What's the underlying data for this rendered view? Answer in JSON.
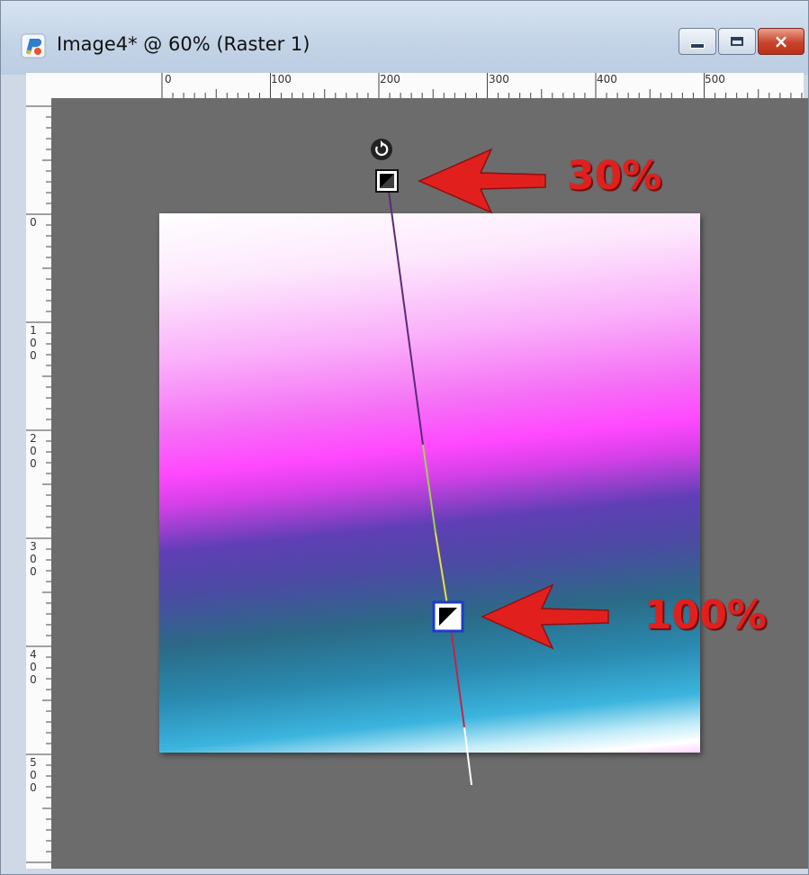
{
  "window": {
    "title": "Image4* @  60% (Raster 1)",
    "icon": "paintshop-pro-icon",
    "buttons": {
      "minimize": "minimize-icon",
      "maximize": "maximize-icon",
      "close_label": "×"
    }
  },
  "rulers": {
    "horizontal_labels": [
      "0",
      "100",
      "200",
      "300",
      "400",
      "500"
    ],
    "vertical_labels": [
      "0",
      "100",
      "200",
      "300",
      "400",
      "500"
    ]
  },
  "gradient_handles": {
    "start": {
      "icon": "gradient-start-handle-icon"
    },
    "end": {
      "icon": "gradient-end-handle-icon"
    },
    "rotate": {
      "icon": "rotate-icon"
    }
  },
  "annotations": {
    "top_label": "30%",
    "bottom_label": "100%",
    "arrow_color": "#e1201e"
  },
  "colors": {
    "workspace": "#6c6c6c",
    "titlebar": "#c4d4e7",
    "selected_handle_border": "#1e3cc8"
  }
}
